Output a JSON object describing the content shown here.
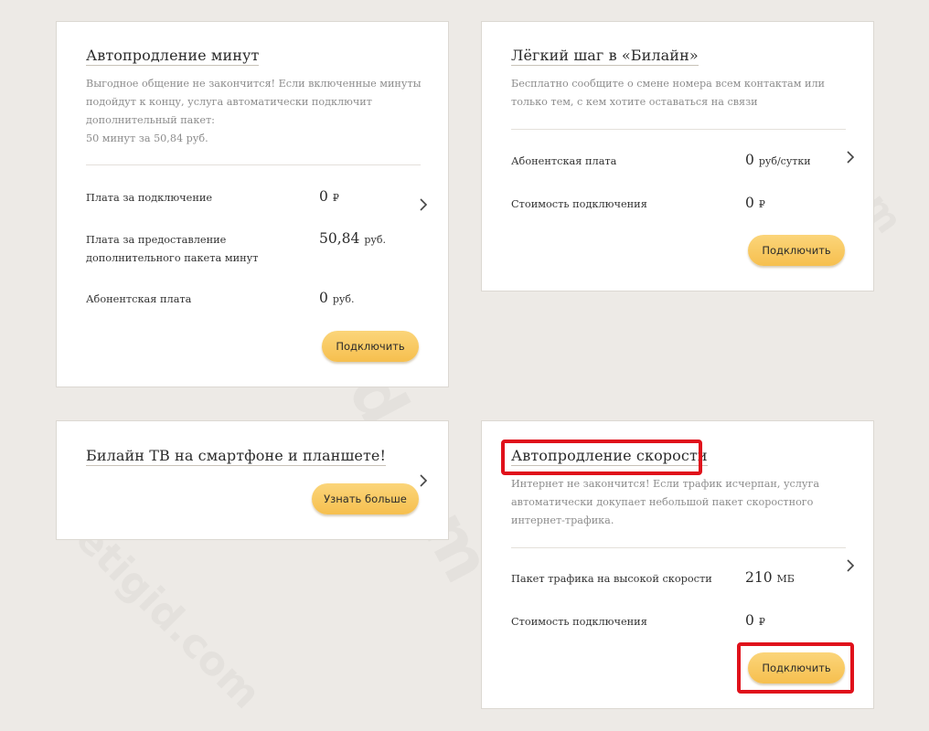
{
  "cards": [
    {
      "title": "Автопродление минут",
      "description": [
        "Выгодное общение не закончится! Если включенные минуты",
        "подойдут к концу, услуга автоматически подключит",
        "дополнительный пакет:",
        "50 минут за 50,84 руб."
      ],
      "rows": [
        {
          "label": "Плата за подключение",
          "value": "0",
          "unit": "₽"
        },
        {
          "label": [
            "Плата за предоставление",
            "дополнительного пакета минут"
          ],
          "value": "50,84",
          "unit": "руб."
        },
        {
          "label": "Абонентская плата",
          "value": "0",
          "unit": "руб."
        }
      ],
      "button": "Подключить"
    },
    {
      "title": "Лёгкий шаг в «Билайн»",
      "description": [
        "Бесплатно сообщите о смене номера всем контактам или",
        "только тем, с кем хотите оставаться на связи"
      ],
      "rows": [
        {
          "label": "Абонентская плата",
          "value": "0",
          "unit": "руб/сутки"
        },
        {
          "label": "Стоимость подключения",
          "value": "0",
          "unit": "₽"
        }
      ],
      "button": "Подключить"
    },
    {
      "title": "Билайн ТВ на смартфоне и планшете!",
      "button": "Узнать больше"
    },
    {
      "title": "Автопродление скорости",
      "description": [
        "Интернет не закончится! Если трафик исчерпан, услуга",
        "автоматически докупает небольшой пакет скоростного",
        "интернет-трафика."
      ],
      "rows": [
        {
          "label": "Пакет трафика на высокой скорости",
          "value": "210",
          "unit": "МБ"
        },
        {
          "label": "Стоимость подключения",
          "value": "0",
          "unit": "₽"
        }
      ],
      "button": "Подключить"
    }
  ],
  "icons": {
    "details": "chevron-right-icon"
  },
  "colors": {
    "button": "#f6bf4e",
    "highlight": "#e0111b",
    "background": "#edeae6"
  },
  "watermark": "setigid.com"
}
